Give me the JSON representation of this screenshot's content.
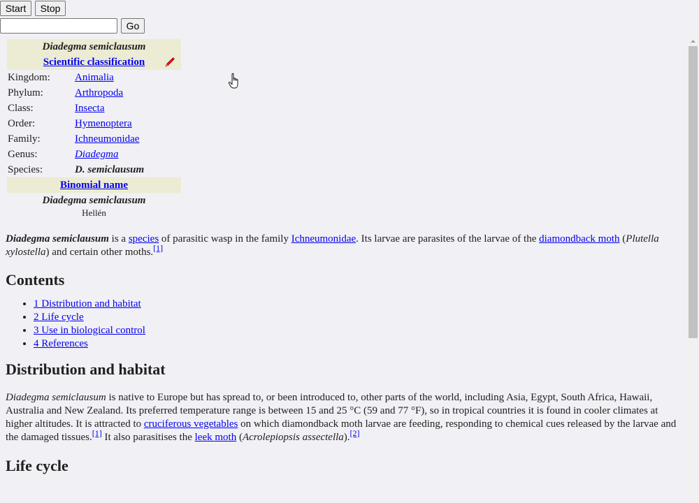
{
  "toolbar": {
    "start_label": "Start",
    "stop_label": "Stop",
    "go_label": "Go",
    "input_value": ""
  },
  "infobox": {
    "title": "Diadegma semiclausum",
    "classification_header": "Scientific classification",
    "rows": [
      {
        "key": "Kingdom:",
        "value": "Animalia",
        "link": true,
        "italic": false
      },
      {
        "key": "Phylum:",
        "value": "Arthropoda",
        "link": true,
        "italic": false
      },
      {
        "key": "Class:",
        "value": "Insecta",
        "link": true,
        "italic": false
      },
      {
        "key": "Order:",
        "value": "Hymenoptera",
        "link": true,
        "italic": false
      },
      {
        "key": "Family:",
        "value": "Ichneumonidae",
        "link": true,
        "italic": false
      },
      {
        "key": "Genus:",
        "value": "Diadegma",
        "link": true,
        "italic": true
      },
      {
        "key": "Species:",
        "value": "D. semiclausum",
        "link": false,
        "italic": true
      }
    ],
    "binomial_header": "Binomial name",
    "binomial": "Diadegma semiclausum",
    "authority": "Hellén"
  },
  "lead": {
    "name": "Diadegma semiclausum",
    "t1": " is a ",
    "l_species": "species",
    "t2": " of parasitic wasp in the family ",
    "l_family": "Ichneumonidae",
    "t3": ". Its larvae are parasites of the larvae of the ",
    "l_moth": "diamondback moth",
    "t4": " (",
    "host": "Plutella xylostella",
    "t5": ") and certain other moths.",
    "ref1": "[1]"
  },
  "contents": {
    "heading": "Contents",
    "items": [
      "1 Distribution and habitat",
      "2 Life cycle",
      "3 Use in biological control",
      "4 References"
    ]
  },
  "distribution": {
    "heading": "Distribution and habitat",
    "name": "Diadegma semiclausum",
    "t1": " is native to Europe but has spread to, or been introduced to, other parts of the world, including Asia, Egypt, South Africa, Hawaii, Australia and New Zealand. Its preferred temperature range is between 15 and 25 °C (59 and 77 °F), so in tropical countries it is found in cooler climates at higher altitudes. It is attracted to ",
    "l_veg": "cruciferous vegetables",
    "t2": " on which diamondback moth larvae are feeding, responding to chemical cues released by the larvae and the damaged tissues.",
    "ref1": "[1]",
    "t3": " It also parasitises the ",
    "l_leek": "leek moth",
    "t4": " (",
    "leek_sci": "Acrolepiopsis assectella",
    "t5": ").",
    "ref2": "[2]"
  },
  "life_cycle": {
    "heading": "Life cycle"
  },
  "icons": {
    "pencil": "pencil-icon",
    "cursor": "hand-pointer-cursor"
  }
}
